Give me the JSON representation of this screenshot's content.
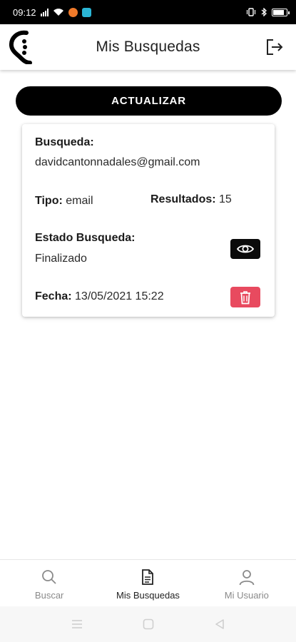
{
  "status_bar": {
    "time": "09:12",
    "colors": {
      "bg": "#000000",
      "notif_orange": "#f07a2a",
      "notif_cyan": "#2bb6d6"
    }
  },
  "header": {
    "title": "Mis Busquedas",
    "logo_icon": "ear-logo-icon",
    "logout_icon": "logout-icon"
  },
  "refresh_button": {
    "label": "ACTUALIZAR"
  },
  "searches": [
    {
      "busqueda_label": "Busqueda:",
      "busqueda_value": "davidcantonnadales@gmail.com",
      "tipo_label": "Tipo:",
      "tipo_value": "email",
      "resultados_label": "Resultados:",
      "resultados_value": "15",
      "estado_label": "Estado Busqueda:",
      "estado_value": "Finalizado",
      "fecha_label": "Fecha:",
      "fecha_value": "13/05/2021 15:22",
      "view_icon": "eye-icon",
      "delete_icon": "trash-icon"
    }
  ],
  "bottom_nav": {
    "items": [
      {
        "label": "Buscar",
        "icon": "search-icon",
        "active": false
      },
      {
        "label": "Mis Busquedas",
        "icon": "document-icon",
        "active": true
      },
      {
        "label": "Mi Usuario",
        "icon": "user-icon",
        "active": false
      }
    ]
  },
  "colors": {
    "primary": "#000000",
    "danger": "#e84a5f",
    "inactive_text": "#8a8a8a",
    "active_text": "#222222"
  }
}
